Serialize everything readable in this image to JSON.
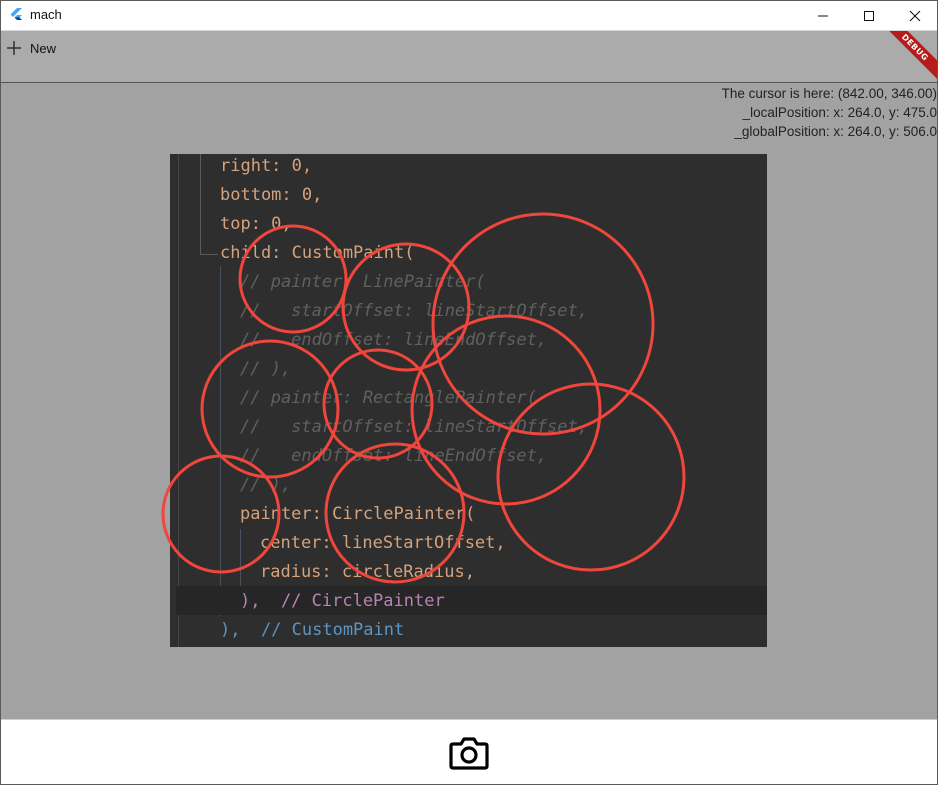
{
  "window": {
    "title": "mach",
    "controls": [
      "minimize",
      "maximize",
      "close"
    ]
  },
  "toolbar": {
    "new_label": "New",
    "debug_banner": "DEBUG"
  },
  "cursor_info": {
    "line1": "The cursor is here: (842.00, 346.00)",
    "line2": "_localPosition: x: 264.0, y: 475.0",
    "line3": "_globalPosition: x: 264.0, y: 506.0"
  },
  "code_lines": [
    {
      "text": "right: 0,"
    },
    {
      "text": "bottom: 0,"
    },
    {
      "text": "top: 0,"
    },
    {
      "text": "child: CustomPaint("
    },
    {
      "text": "// painter: LinePainter("
    },
    {
      "text": "//   startOffset: lineStartOffset,"
    },
    {
      "text": "//   endOffset: lineEndOffset,"
    },
    {
      "text": "// ),"
    },
    {
      "text": "// painter: RectanglePainter("
    },
    {
      "text": "//   startOffset: lineStartOffset,"
    },
    {
      "text": "//   endOffset: lineEndOffset,"
    },
    {
      "text": "// ),"
    },
    {
      "text": "painter: CirclePainter("
    },
    {
      "text": "center: lineStartOffset,"
    },
    {
      "text": "radius: circleRadius,"
    },
    {
      "text": "),  // CirclePainter"
    },
    {
      "text": "),  // CustomPaint"
    }
  ],
  "colors": {
    "circle_stroke": "#f0463c",
    "canvas_overlay": "#a2a2a2",
    "toolbar_bg": "#ababab",
    "debug_red": "#b71c1c"
  },
  "icons": {
    "app": "flutter-logo-icon",
    "new": "plus-icon",
    "capture": "camera-icon"
  }
}
